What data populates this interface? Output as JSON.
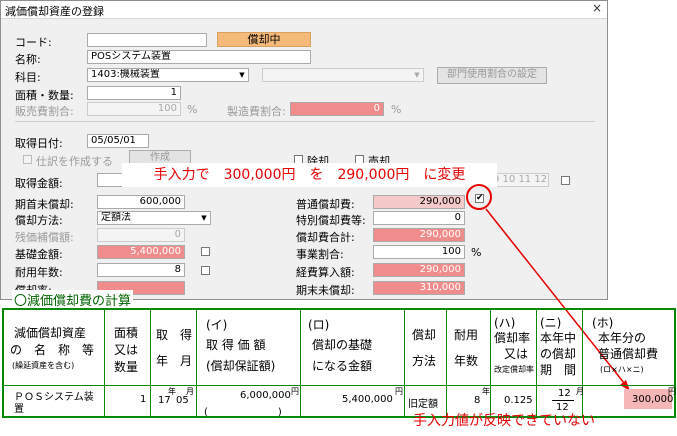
{
  "window": {
    "title": "減価償却資産の登録",
    "close": "×"
  },
  "form": {
    "code_label": "コード:",
    "code_value": "",
    "status_badge": "償却中",
    "name_label": "名称:",
    "name_value": "POSシステム装置",
    "subject_label": "科目:",
    "subject_value": "1403:機械装置",
    "subject2_value": "",
    "dept_button": "部門使用割合の設定",
    "qty_label": "面積・数量:",
    "qty_value": "1",
    "sales_ratio_label": "販売費割合:",
    "sales_ratio_value": "100",
    "percent": "%",
    "mfg_ratio_label": "製造費割合:",
    "mfg_ratio_value": "0",
    "acq_date_label": "取得日付:",
    "acq_date_value": "05/05/01",
    "journal_label": "仕訳を作成する",
    "create_button": "作成",
    "removal_label": "除却",
    "sale_label": "売却",
    "acq_amount_label": "取得金額:",
    "month_nums": "9 10 11 12",
    "opening_label": "期首未償却:",
    "opening_value": "600,000",
    "normal_dep_label": "普通償却費:",
    "normal_dep_value": "290,000",
    "method_label": "償却方法:",
    "method_value": "定額法",
    "special_dep_label": "特別償却費等:",
    "special_dep_value": "0",
    "residual_label": "残価補償額:",
    "residual_value": "0",
    "dep_total_label": "償却費合計:",
    "dep_total_value": "290,000",
    "base_label": "基礎金額:",
    "base_value": "5,400,000",
    "business_ratio_label": "事業割合:",
    "business_ratio_value": "100",
    "life_label": "耐用年数:",
    "life_value": "8",
    "expense_label": "経費算入額:",
    "expense_value": "290,000",
    "rate_label": "償却率:",
    "closing_label": "期末未償却:",
    "closing_value": "310,000"
  },
  "annotation": {
    "main": "手入力で　300,000円　を　290,000円　に変更",
    "footer": "手入力値が反映できていない"
  },
  "calc": {
    "title": "〇減価償却費の計算",
    "headers": {
      "asset_1": "減価償却資産",
      "asset_2": "の　名　称　等",
      "asset_3": "(繰延資産を含む)",
      "qty_1": "面積",
      "qty_2": "又は",
      "qty_3": "数量",
      "date_1": "取　得",
      "date_2": "年　月",
      "cost_kana": "(イ)",
      "cost_1": "取 得 価 額",
      "cost_2": "(償却保証額)",
      "base_kana": "(ロ)",
      "base_1": "償却の基礎",
      "base_2": "になる金額",
      "method_1": "償却",
      "method_2": "方法",
      "life_1": "耐用",
      "life_2": "年数",
      "rate_kana": "(ハ)",
      "rate_1": "償却率",
      "rate_2": "又は",
      "rate_3": "改定償却率",
      "months_kana": "(ニ)",
      "months_1": "本年中",
      "months_2": "の償却",
      "months_3": "期　間",
      "dep_kana": "(ホ)",
      "dep_1": "本年分の",
      "dep_2": "普通償却費",
      "dep_3": "(ロ×ハ×ニ)"
    },
    "row": {
      "name_1": "ＰＯＳシステム装",
      "name_2": "置",
      "qty": "1",
      "year_unit": "年",
      "month_unit": "月",
      "year": "17",
      "month": "05",
      "cost": "6,000,000",
      "yen": "円",
      "guarantee": "(　　　　　　　)",
      "base": "5,400,000",
      "method": "旧定額",
      "life": "8",
      "life_unit": "年",
      "rate": "0.125",
      "months_num": "12",
      "month_unit2": "月",
      "months_den": "12",
      "dep": "300,000"
    }
  },
  "colors": {
    "accent_pink": "#f08c8c",
    "badge": "#f5b97a",
    "annot_red": "#e60000",
    "table_green": "#0a8a0a"
  }
}
